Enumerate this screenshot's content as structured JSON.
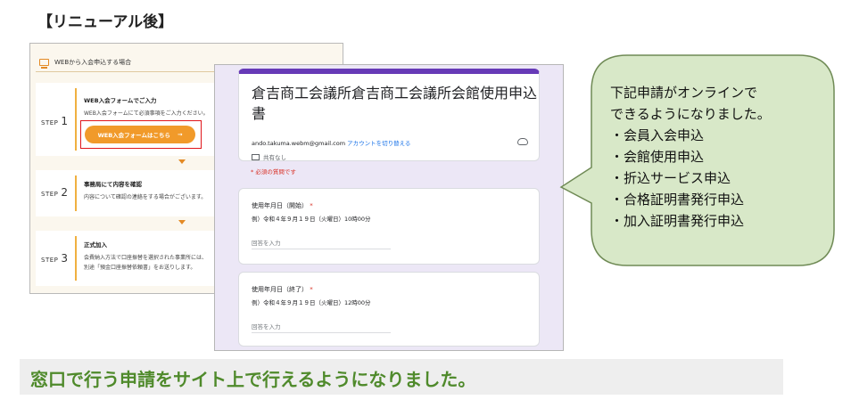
{
  "heading": "【リニューアル後】",
  "web_panel": {
    "header": "WEBから入会申込する場合",
    "steps": [
      {
        "label": "STEP",
        "number": "1",
        "title": "WEB入会フォームでご入力",
        "text": "WEB入会フォームにて必須事項をご入力ください。",
        "button_label": "WEB入会フォームはこちら",
        "button_arrow": "→"
      },
      {
        "label": "STEP",
        "number": "2",
        "title": "事務局にて内容を確認",
        "text": "内容について確認の連絡をする場合がございます。"
      },
      {
        "label": "STEP",
        "number": "3",
        "title": "正式加入",
        "text_line1": "会費納入方法で口座振替を選択された事業所には、",
        "text_line2": "別途「預金口座振替依頼書」をお送りします。"
      }
    ]
  },
  "form": {
    "title": "倉吉商工会議所倉吉商工会議所会館使用申込書",
    "account_email": "ando.takuma.webm@gmail.com",
    "switch_account": "アカウントを切り替える",
    "shared": "共有なし",
    "required_note": "* 必須の質問です",
    "questions": [
      {
        "title": "使用年月日（開始）",
        "required_mark": "*",
        "example": "例）令和４年９月１９日（火曜日）10時00分",
        "placeholder": "回答を入力"
      },
      {
        "title": "使用年月日（終了）",
        "required_mark": "*",
        "example": "例）令和４年９月１９日（火曜日）12時00分",
        "placeholder": "回答を入力"
      }
    ]
  },
  "bubble": {
    "line1": "下記申請がオンラインで",
    "line2": "できるようになりました。",
    "items": [
      "会員入会申込",
      "会館使用申込",
      "折込サービス申込",
      "合格証明書発行申込",
      "加入証明書発行申込"
    ],
    "fill_color": "#d8e8c8",
    "stroke_color": "#6f8a55"
  },
  "banner": {
    "text": "窓口で行う申請をサイト上で行えるようになりました。",
    "text_color": "#4f8a2b"
  },
  "colors": {
    "form_accent": "#673ab7",
    "button": "#f19a2a",
    "highlight_box": "#e0161b"
  }
}
